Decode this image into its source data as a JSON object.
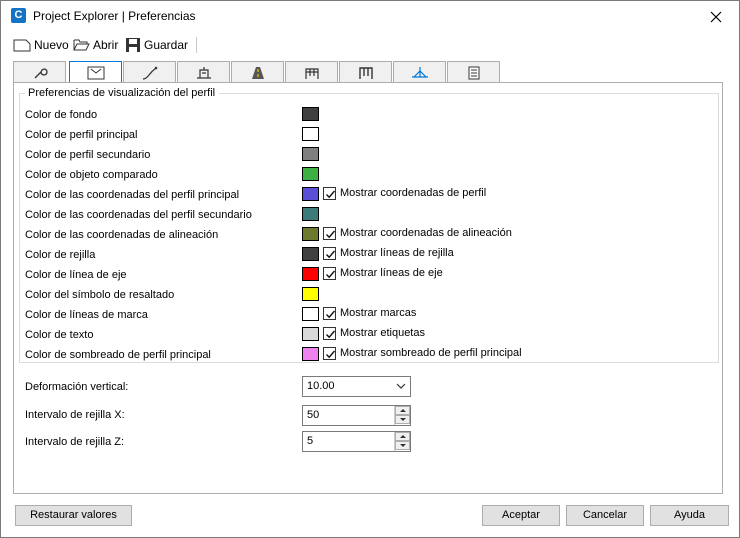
{
  "window": {
    "title": "Project Explorer | Preferencias",
    "app_icon": "C"
  },
  "toolbar": {
    "new_label": "Nuevo",
    "open_label": "Abrir",
    "save_label": "Guardar"
  },
  "group": {
    "title": "Preferencias de visualización del perfil"
  },
  "color_rows": [
    {
      "label": "Color de fondo",
      "color": "#404040"
    },
    {
      "label": "Color de perfil principal",
      "color": "#ffffff"
    },
    {
      "label": "Color de perfil secundario",
      "color": "#7f7f7f"
    },
    {
      "label": "Color de objeto comparado",
      "color": "#3cb043"
    },
    {
      "label": "Color de las coordenadas del perfil principal",
      "color": "#5b4fd6",
      "check_label": "Mostrar coordenadas de perfil"
    },
    {
      "label": "Color de las coordenadas del perfil secundario",
      "color": "#3d7a7a"
    },
    {
      "label": "Color de las coordenadas de alineación",
      "color": "#6b7a2c",
      "check_label": "Mostrar coordenadas de alineación"
    },
    {
      "label": "Color de rejilla",
      "color": "#404040",
      "check_label": "Mostrar líneas de rejilla"
    },
    {
      "label": "Color de línea de eje",
      "color": "#ff0000",
      "check_label": "Mostrar líneas de eje"
    },
    {
      "label": "Color del símbolo de resaltado",
      "color": "#ffff00"
    },
    {
      "label": "Color de líneas de marca",
      "color": "#ffffff",
      "check_label": "Mostrar marcas"
    },
    {
      "label": "Color de texto",
      "color": "#d9d9d9",
      "check_label": "Mostrar etiquetas"
    },
    {
      "label": "Color de sombreado de perfil principal",
      "color": "#ee82ee",
      "check_label": "Mostrar sombreado de perfil principal"
    }
  ],
  "fields": {
    "vertical_label": "Deformación vertical:",
    "vertical_value": "10.00",
    "grid_x_label": "Intervalo de rejilla X:",
    "grid_x_value": "50",
    "grid_z_label": "Intervalo de rejilla Z:",
    "grid_z_value": "5"
  },
  "buttons": {
    "restore": "Restaurar valores",
    "accept": "Aceptar",
    "cancel": "Cancelar",
    "help": "Ayuda"
  }
}
